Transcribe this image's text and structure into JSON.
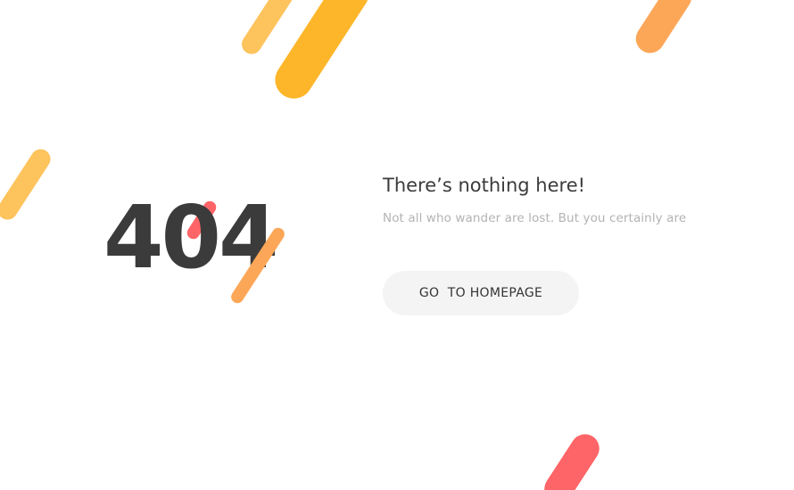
{
  "error": {
    "code": "404"
  },
  "message": {
    "headline": "There’s nothing here!",
    "subtitle": "Not all who wander are lost. But you certainly are"
  },
  "actions": {
    "home_label": "GO  TO HOMEPAGE"
  },
  "colors": {
    "background": "#ffffff",
    "text_dark": "#3b3b3b",
    "text_muted": "#b3b3b3",
    "button_background": "#f4f4f4",
    "accent_yellow": "#fdb62a",
    "accent_light_orange": "#fdc35c",
    "accent_orange": "#fca758",
    "accent_red": "#fe6568"
  }
}
